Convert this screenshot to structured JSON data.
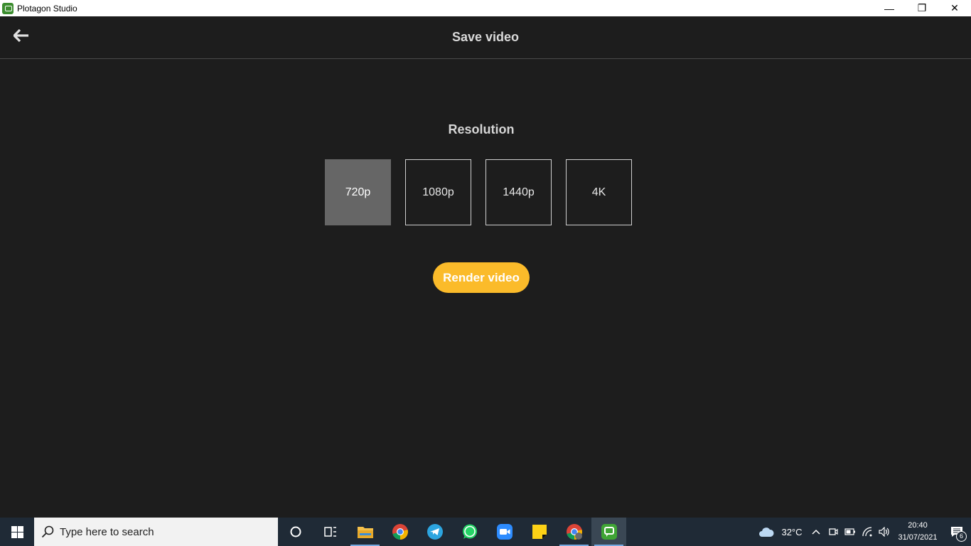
{
  "window": {
    "title": "Plotagon Studio",
    "controls": {
      "minimize": "—",
      "restore": "❐",
      "close": "✕"
    }
  },
  "header": {
    "title": "Save video",
    "back_icon": "arrow-left-icon"
  },
  "resolution": {
    "label": "Resolution",
    "options": [
      "720p",
      "1080p",
      "1440p",
      "4K"
    ],
    "selected": "720p"
  },
  "render_button": {
    "label": "Render video",
    "color": "#fbbb2a"
  },
  "taskbar": {
    "search_placeholder": "Type here to search",
    "weather": "32°C",
    "time": "20:40",
    "date": "31/07/2021",
    "notifications": "6"
  }
}
